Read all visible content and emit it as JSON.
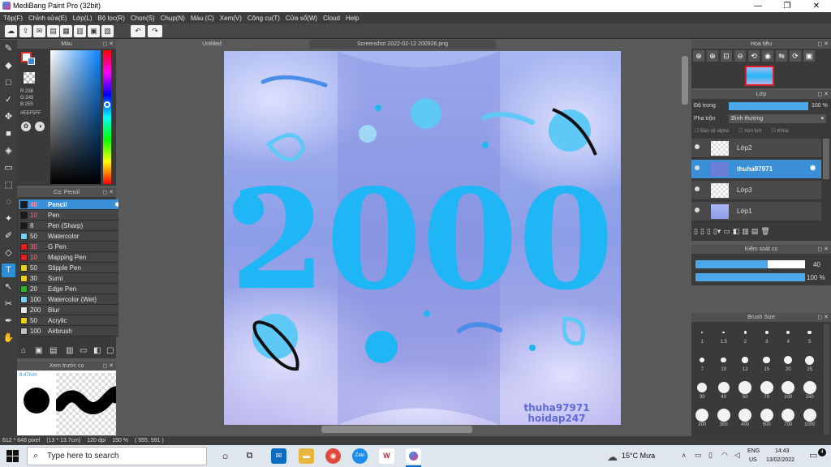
{
  "window": {
    "title": "MediBang Paint Pro (32bit)",
    "min": "—",
    "max": "❐",
    "close": "✕"
  },
  "menu": [
    "Tệp(F)",
    "Chỉnh sửa(E)",
    "Lớp(L)",
    "Bộ lọc(R)",
    "Chọn(S)",
    "Chụp(N)",
    "Màu (C)",
    "Xem(V)",
    "Công cụ(T)",
    "Cửa sổ(W)",
    "Cloud",
    "Help"
  ],
  "color_panel": {
    "title": "Màu",
    "r": "R:238",
    "g": "G:245",
    "b": "B:255",
    "hex": "#EEF5FF"
  },
  "brush_panel": {
    "title": "Cọ: Pencil",
    "items": [
      {
        "size": "40",
        "name": "Pencil",
        "color": "#1a1a1a",
        "selected": true
      },
      {
        "size": "10",
        "name": "Pen",
        "color": "#1a1a1a"
      },
      {
        "size": "8",
        "name": "Pen (Sharp)",
        "color": "#1a1a1a",
        "white": true
      },
      {
        "size": "50",
        "name": "Watercolor",
        "color": "#7fd0f0",
        "white": true
      },
      {
        "size": "30",
        "name": "G Pen",
        "color": "#e02020"
      },
      {
        "size": "10",
        "name": "Mapping Pen",
        "color": "#e02020"
      },
      {
        "size": "50",
        "name": "Stipple Pen",
        "color": "#e8d020",
        "white": true
      },
      {
        "size": "30",
        "name": "Sumi",
        "color": "#e8d020",
        "white": true
      },
      {
        "size": "20",
        "name": "Edge Pen",
        "color": "#30b030",
        "white": true
      },
      {
        "size": "100",
        "name": "Watercolor (Wet)",
        "color": "#7fd0f0",
        "white": true
      },
      {
        "size": "200",
        "name": "Blur",
        "color": "#e8e8e8",
        "white": true
      },
      {
        "size": "50",
        "name": "Acrylic",
        "color": "#e8d020",
        "white": true
      },
      {
        "size": "100",
        "name": "Airbrush",
        "color": "#c0c0c0",
        "white": true
      }
    ]
  },
  "preview_panel": {
    "title": "Xem trước cọ",
    "size": "8.47mm"
  },
  "canvas": {
    "tab_untitled": "Untitled",
    "tab_file": "Screenshot 2022-02-12 200926.png",
    "art_text": "2000",
    "watermark1": "thuha97971",
    "watermark2": "hoidap247"
  },
  "navigator": {
    "title": "Hoa tiêu"
  },
  "layers": {
    "title": "Lớp",
    "opacity_label": "Độ trong",
    "opacity_value": "100 %",
    "opacity": 1.0,
    "blend_label": "Pha trộn",
    "blend_value": "Bình thường",
    "protect_alpha": "Bảo vệ alpha",
    "clip": "Xén bớt",
    "lock": "Khóa",
    "items": [
      {
        "name": "Lớp2"
      },
      {
        "name": "thuha97971",
        "selected": true
      },
      {
        "name": "Lớp3"
      },
      {
        "name": "Lớp1"
      }
    ]
  },
  "brush_control": {
    "title": "Kiểm soát cọ",
    "size_value": "40",
    "size_fraction": 0.66,
    "opacity_value": "100 %",
    "opacity_fraction": 1.0
  },
  "brush_size": {
    "title": "Brush Size",
    "sizes": [
      "1",
      "1.5",
      "2",
      "3",
      "4",
      "5",
      "7",
      "10",
      "12",
      "15",
      "20",
      "25",
      "30",
      "40",
      "50",
      "70",
      "100",
      "150",
      "200",
      "300",
      "400",
      "500",
      "700",
      "1000"
    ]
  },
  "status": {
    "dims": "612 * 648 pixel",
    "cm": "(13 * 13.7cm)",
    "dpi": "120 dpi",
    "zoom": "150 %",
    "coords": "( 555, 591 )"
  },
  "taskbar": {
    "search_placeholder": "Type here to search",
    "weather": "15°C  Mưa",
    "lang1": "ENG",
    "lang2": "US",
    "time": "14:43",
    "date": "13/02/2022",
    "notif": "4"
  },
  "colors": {
    "accent": "#2e8fd6",
    "art_blue": "#1fb6f5"
  }
}
